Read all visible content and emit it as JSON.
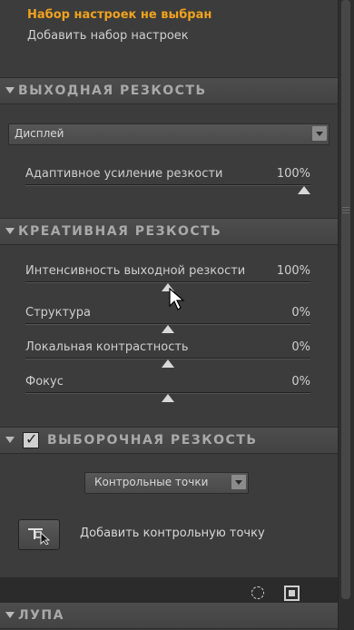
{
  "preset": {
    "title": "Набор настроек не выбран",
    "add_link": "Добавить набор настроек"
  },
  "output_sharpening": {
    "header": "ВЫХОДНАЯ РЕЗКОСТЬ",
    "dropdown_value": "Дисплей",
    "sliders": [
      {
        "label": "Адаптивное усиление резкости",
        "value": "100%",
        "level": 1.0
      }
    ]
  },
  "creative_sharpening": {
    "header": "КРЕАТИВНАЯ РЕЗКОСТЬ",
    "sliders": [
      {
        "label": "Интенсивность выходной резкости",
        "value": "100%",
        "level": 0.5
      },
      {
        "label": "Структура",
        "value": "0%",
        "level": 0.5
      },
      {
        "label": "Локальная контрастность",
        "value": "0%",
        "level": 0.5
      },
      {
        "label": "Фокус",
        "value": "0%",
        "level": 0.5
      }
    ]
  },
  "selective_sharpening": {
    "header": "ВЫБОРОЧНАЯ РЕЗКОСТЬ",
    "enabled": true,
    "dropdown_value": "Контрольные точки",
    "add_point_label": "Добавить контрольную точку"
  },
  "loupe": {
    "header": "ЛУПА"
  },
  "icons": {
    "check": "✓",
    "bottom_left": "circle-dashed-icon",
    "bottom_right": "square-target-icon"
  }
}
